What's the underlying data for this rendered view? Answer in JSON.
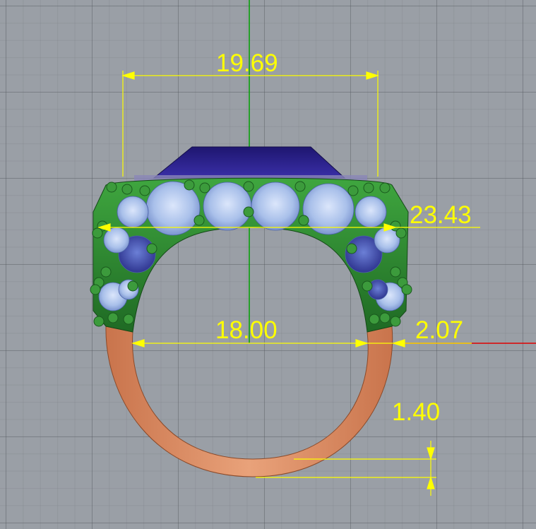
{
  "viewport": {
    "label": "3D ring model viewport"
  },
  "dimensions": {
    "top_width": "19.69",
    "height": "23.43",
    "inner_diameter": "18.00",
    "shank_thickness": "2.07",
    "band_thickness": "1.40"
  },
  "colors": {
    "dimension": "#ffff00",
    "axis_y": "#00a000",
    "axis_x": "#e00000",
    "setting": "#2f8a2f",
    "shank": "#d98a60",
    "center_stone": "#2a1f8a",
    "side_stone": "#a9c0ea",
    "deep_stone": "#3a4aa8"
  }
}
